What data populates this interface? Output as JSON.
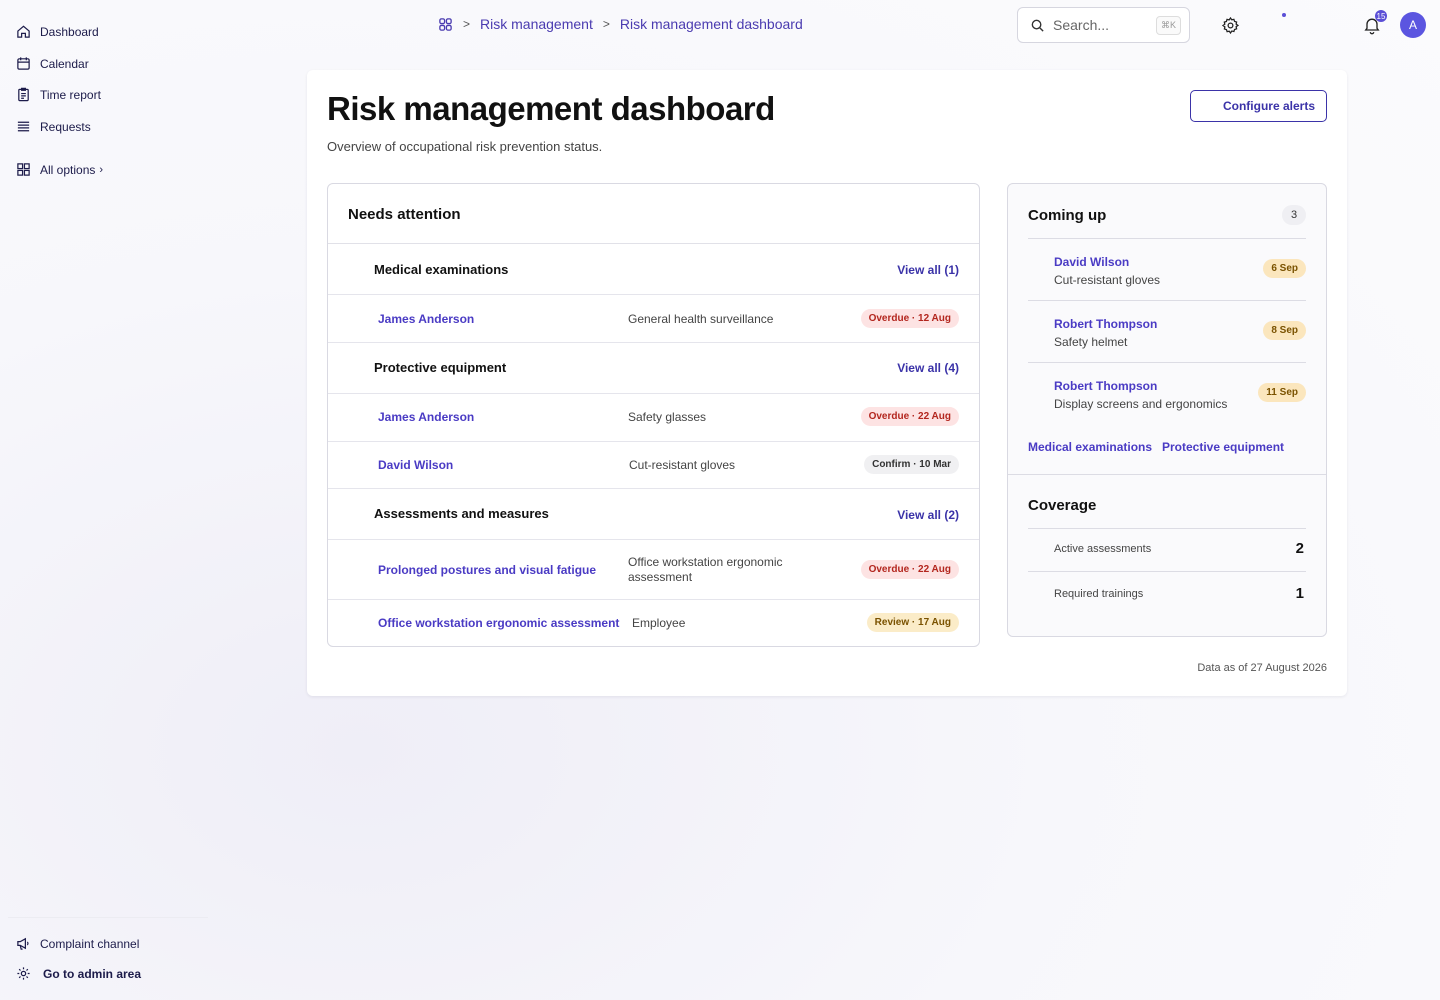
{
  "sidebar": {
    "items": [
      {
        "label": "Dashboard",
        "icon": "home-icon"
      },
      {
        "label": "Calendar",
        "icon": "calendar-icon"
      },
      {
        "label": "Time report",
        "icon": "clipboard-icon"
      },
      {
        "label": "Requests",
        "icon": "list-icon"
      }
    ],
    "all_options": "All options",
    "bottom": [
      {
        "label": "Complaint channel",
        "icon": "megaphone-icon"
      },
      {
        "label": "Go to admin area",
        "icon": "gear-icon"
      }
    ]
  },
  "topbar": {
    "breadcrumb": [
      "Risk management",
      "Risk management dashboard"
    ],
    "search_placeholder": "Search...",
    "search_shortcut": "⌘K",
    "notifications_count": "15",
    "avatar_initial": "A"
  },
  "page": {
    "title": "Risk management dashboard",
    "subtitle": "Overview of occupational risk prevention status.",
    "configure_label": "Configure alerts",
    "data_as_of": "Data as of 27 August 2026"
  },
  "attention": {
    "title": "Needs attention",
    "groups": [
      {
        "title": "Medical examinations",
        "link": "View all (1)",
        "rows": [
          {
            "name": "James Anderson",
            "desc": "General health surveillance",
            "status": "Overdue · 12 Aug",
            "tone": "red"
          }
        ]
      },
      {
        "title": "Protective equipment",
        "link": "View all (4)",
        "rows": [
          {
            "name": "James Anderson",
            "desc": "Safety glasses",
            "status": "Overdue · 22 Aug",
            "tone": "red"
          },
          {
            "name": "David Wilson",
            "desc": "Cut-resistant gloves",
            "status": "Confirm · 10 Mar",
            "tone": "gray"
          }
        ]
      },
      {
        "title": "Assessments and measures",
        "link": "View all (2)",
        "rows": [
          {
            "name": "Prolonged postures and visual fatigue",
            "desc": "Office workstation ergonomic assessment",
            "status": "Overdue · 22 Aug",
            "tone": "red"
          },
          {
            "name": "Office workstation ergonomic assessment",
            "desc": "Employee",
            "status": "Review · 17 Aug",
            "tone": "yellow"
          }
        ]
      }
    ]
  },
  "coming_up": {
    "title": "Coming up",
    "count": "3",
    "items": [
      {
        "name": "David Wilson",
        "desc": "Cut-resistant gloves",
        "date": "6 Sep"
      },
      {
        "name": "Robert Thompson",
        "desc": "Safety helmet",
        "date": "8 Sep"
      },
      {
        "name": "Robert Thompson",
        "desc": "Display screens and ergonomics",
        "date": "11 Sep"
      }
    ],
    "links": [
      "Medical examinations",
      "Protective equipment"
    ]
  },
  "coverage": {
    "title": "Coverage",
    "rows": [
      {
        "label": "Active assessments",
        "value": "2"
      },
      {
        "label": "Required trainings",
        "value": "1"
      }
    ]
  },
  "colors": {
    "accent": "#3b33a8",
    "link": "#4a3bc4",
    "danger": "#b3261e",
    "warning": "#7a5200"
  }
}
